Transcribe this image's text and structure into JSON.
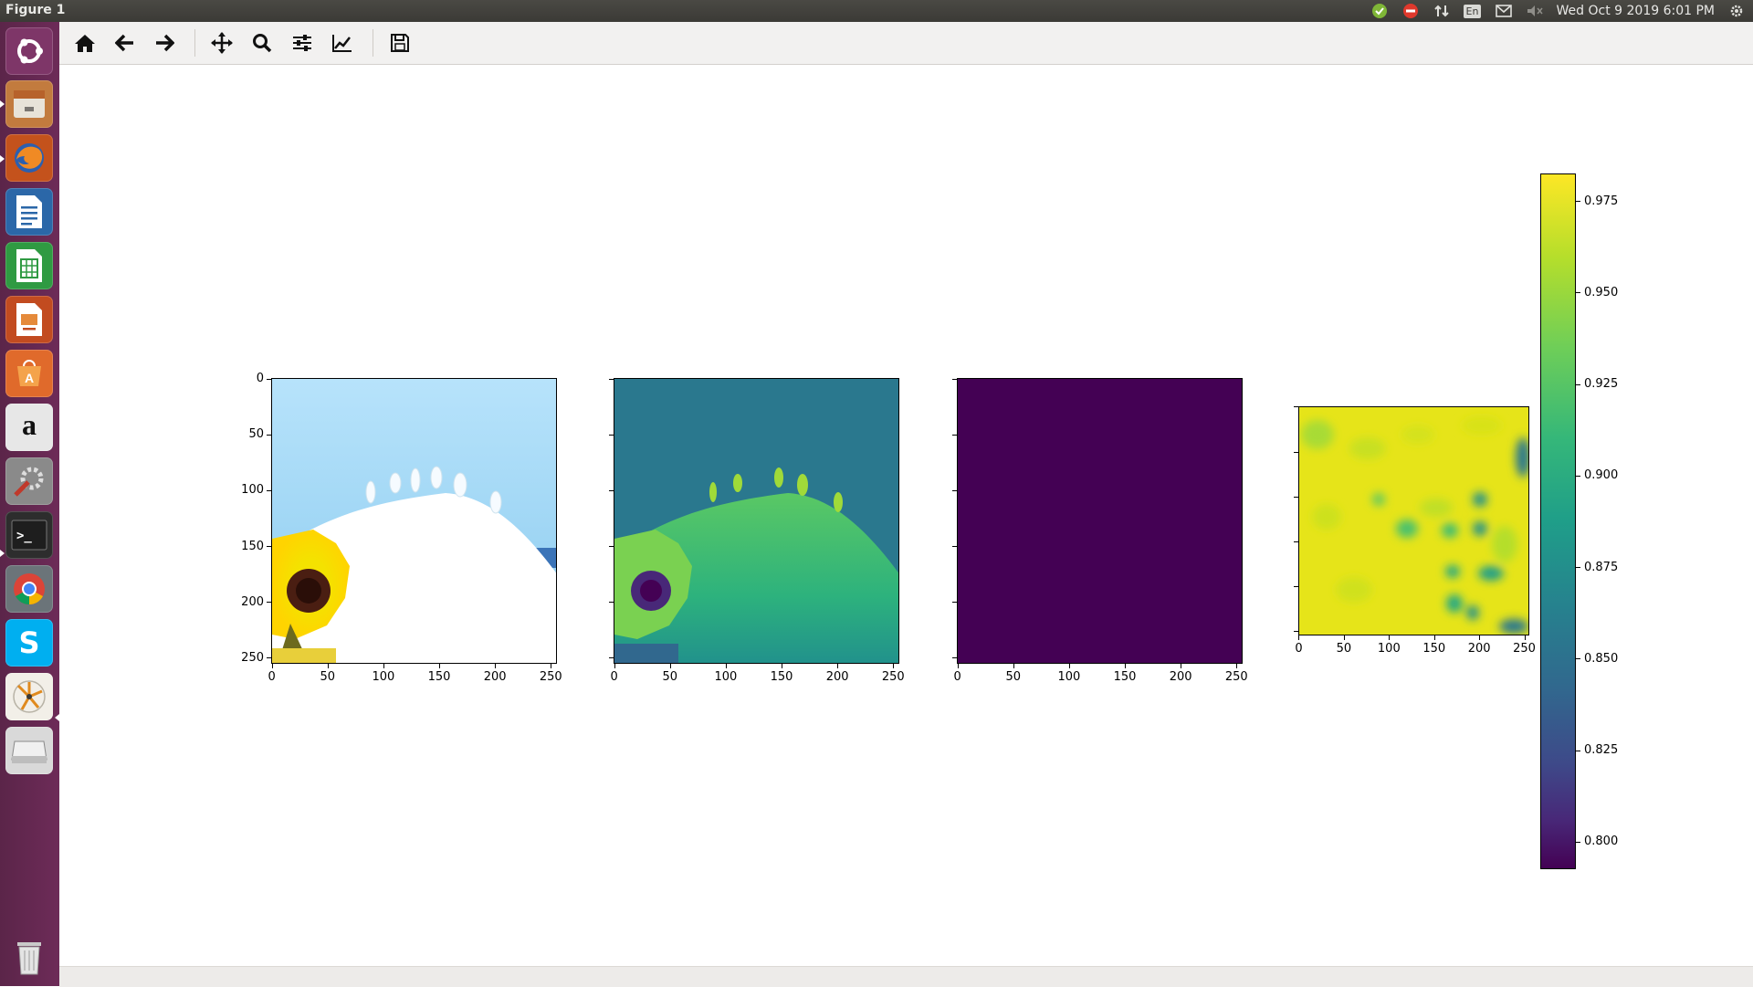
{
  "window": {
    "title": "Figure 1"
  },
  "top_panel": {
    "clock": "Wed Oct  9 2019  6:01 PM",
    "keyboard_layout": "En",
    "icons": [
      "status-ok-icon",
      "no-entry-icon",
      "network-arrows-icon",
      "keyboard-layout-icon",
      "mail-icon",
      "volume-muted-icon",
      "settings-gear-icon"
    ]
  },
  "launcher": {
    "items": [
      "ubuntu-dash-icon",
      "files-icon",
      "firefox-icon",
      "libreoffice-writer-icon",
      "libreoffice-calc-icon",
      "libreoffice-impress-icon",
      "software-center-icon",
      "amazon-icon",
      "system-settings-icon",
      "terminal-icon",
      "chrome-icon",
      "skype-icon",
      "app-icon",
      "disk-drive-icon",
      "trash-icon"
    ],
    "labels": {
      "amazon": "a",
      "skype": "S",
      "terminal": ">_"
    }
  },
  "toolbar": {
    "buttons": [
      "home-icon",
      "back-icon",
      "forward-icon",
      "pan-icon",
      "zoom-icon",
      "configure-subplots-icon",
      "edit-axes-icon",
      "save-icon"
    ]
  },
  "colors": {
    "sky": "#9dd3f0",
    "viridis_dark": "#440154",
    "viridis_teal": "#2a788e",
    "viridis_yellow": "#fde725",
    "launcher_bg": "#6d2b58"
  },
  "chart_data": [
    {
      "type": "image",
      "description": "RGB input image",
      "x_ticks": [
        "0",
        "50",
        "100",
        "150",
        "200",
        "250"
      ],
      "y_ticks": [
        "0",
        "50",
        "100",
        "150",
        "200",
        "250"
      ],
      "xlim": [
        0,
        256
      ],
      "ylim": [
        256,
        0
      ]
    },
    {
      "type": "image",
      "description": "single channel image (viridis)",
      "x_ticks": [
        "0",
        "50",
        "100",
        "150",
        "200",
        "250"
      ],
      "xlim": [
        0,
        256
      ],
      "ylim": [
        256,
        0
      ]
    },
    {
      "type": "image",
      "description": "constant image (viridis min)",
      "x_ticks": [
        "0",
        "50",
        "100",
        "150",
        "200",
        "250"
      ],
      "xlim": [
        0,
        256
      ],
      "ylim": [
        256,
        0
      ]
    },
    {
      "type": "heatmap",
      "description": "map with colorbar",
      "x_ticks": [
        "0",
        "50",
        "100",
        "150",
        "200",
        "250"
      ],
      "xlim": [
        0,
        256
      ],
      "ylim": [
        256,
        0
      ],
      "colorbar": {
        "ticks": [
          "0.975",
          "0.950",
          "0.925",
          "0.900",
          "0.875",
          "0.850",
          "0.825",
          "0.800"
        ],
        "tick_values": [
          0.975,
          0.95,
          0.925,
          0.9,
          0.875,
          0.85,
          0.825,
          0.8
        ],
        "range": [
          0.7925,
          0.9825
        ],
        "colormap": "viridis"
      }
    }
  ]
}
